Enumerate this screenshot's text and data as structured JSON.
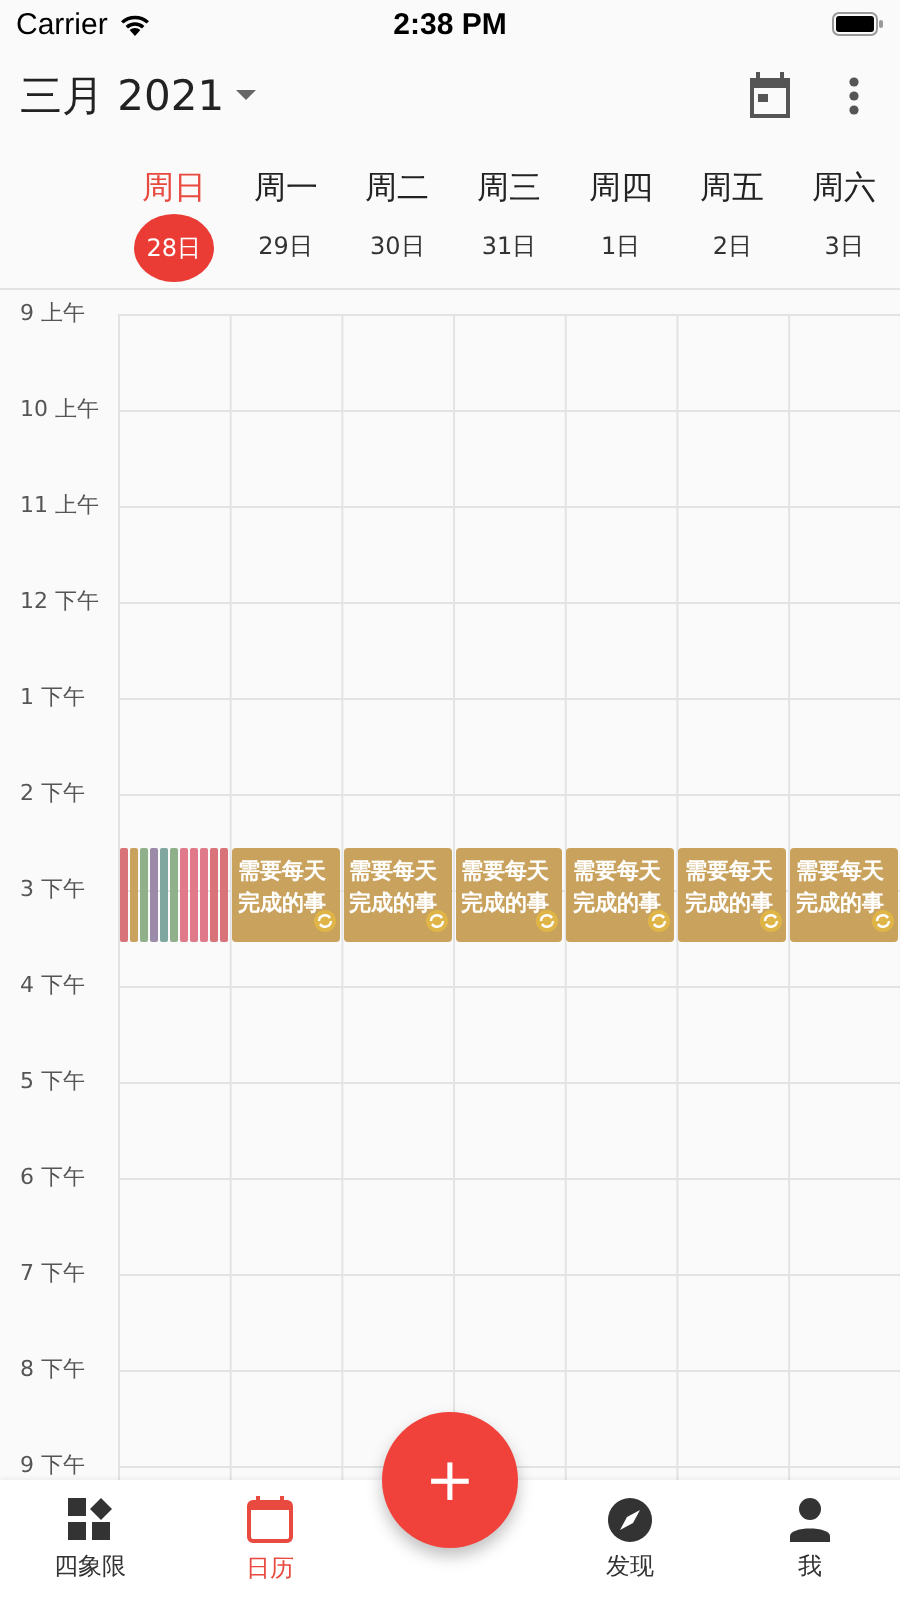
{
  "status_bar": {
    "carrier": "Carrier",
    "time": "2:38 PM"
  },
  "header": {
    "title": "三月 2021"
  },
  "days": [
    {
      "weekday": "周日",
      "date": "28日",
      "selected": true
    },
    {
      "weekday": "周一",
      "date": "29日",
      "selected": false
    },
    {
      "weekday": "周二",
      "date": "30日",
      "selected": false
    },
    {
      "weekday": "周三",
      "date": "31日",
      "selected": false
    },
    {
      "weekday": "周四",
      "date": "1日",
      "selected": false
    },
    {
      "weekday": "周五",
      "date": "2日",
      "selected": false
    },
    {
      "weekday": "周六",
      "date": "3日",
      "selected": false
    }
  ],
  "hours": [
    {
      "label": "9 上午"
    },
    {
      "label": "10 上午"
    },
    {
      "label": "11 上午"
    },
    {
      "label": "12 下午"
    },
    {
      "label": "1 下午"
    },
    {
      "label": "2 下午"
    },
    {
      "label": "3 下午",
      "events": [
        {
          "kind": "stripes",
          "stripes": [
            {
              "color": "#d9737a"
            },
            {
              "color": "#c9a35e"
            },
            {
              "color": "#8fb08a"
            },
            {
              "color": "#9b8aa8"
            },
            {
              "color": "#7fa7a0"
            },
            {
              "color": "#8fb08a"
            },
            {
              "color": "#e07a8a"
            },
            {
              "color": "#e07a8a"
            },
            {
              "color": "#e07a8a"
            },
            {
              "color": "#d9737a"
            },
            {
              "color": "#d9737a"
            }
          ]
        },
        {
          "kind": "card",
          "lines": [
            "需要每天",
            "完成的事"
          ],
          "repeating": true
        },
        {
          "kind": "card",
          "lines": [
            "需要每天",
            "完成的事"
          ],
          "repeating": true
        },
        {
          "kind": "card",
          "lines": [
            "需要每天",
            "完成的事"
          ],
          "repeating": true
        },
        {
          "kind": "card",
          "lines": [
            "需要每天",
            "完成的事"
          ],
          "repeating": true
        },
        {
          "kind": "card",
          "lines": [
            "需要每天",
            "完成的事"
          ],
          "repeating": true
        },
        {
          "kind": "card",
          "lines": [
            "需要每天",
            "完成的事"
          ],
          "repeating": true
        }
      ]
    },
    {
      "label": "4 下午"
    },
    {
      "label": "5 下午"
    },
    {
      "label": "6 下午"
    },
    {
      "label": "7 下午"
    },
    {
      "label": "8 下午"
    },
    {
      "label": "9 下午"
    }
  ],
  "fab": {
    "label": "+"
  },
  "nav": [
    {
      "kind": "quadrant",
      "label": "四象限",
      "selected": false
    },
    {
      "kind": "calendar",
      "label": "日历",
      "selected": true
    },
    {
      "kind": "gap"
    },
    {
      "kind": "discover",
      "label": "发现",
      "selected": false
    },
    {
      "kind": "me",
      "label": "我",
      "selected": false
    }
  ]
}
